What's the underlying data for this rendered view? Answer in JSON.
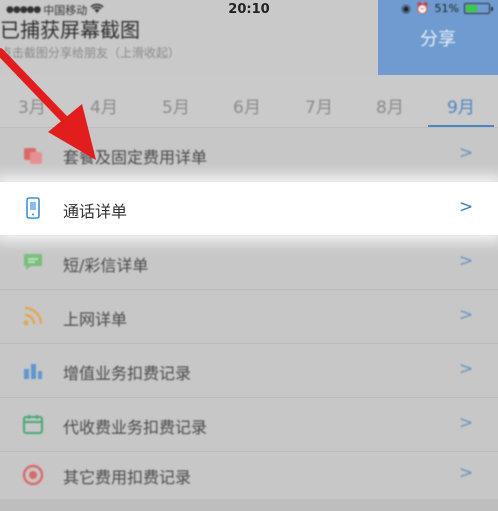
{
  "status_bar": {
    "carrier": "中国移动",
    "time": "20:10",
    "battery": "51%"
  },
  "capture": {
    "title": "已捕获屏幕截图",
    "subtitle": "点击截图分享给朋友（上滑收起）",
    "share_label": "分享"
  },
  "months": {
    "tabs": [
      "3月",
      "4月",
      "5月",
      "6月",
      "7月",
      "8月",
      "9月"
    ],
    "active_index": 6
  },
  "menu": {
    "items": [
      {
        "label": "套餐及固定费用详单",
        "icon": "package-icon",
        "color": "#e25b5b"
      },
      {
        "label": "通话详单",
        "icon": "phone-icon",
        "color": "#3b8fd6"
      },
      {
        "label": "短/彩信详单",
        "icon": "message-icon",
        "color": "#4caf50"
      },
      {
        "label": "上网详单",
        "icon": "rss-icon",
        "color": "#f0a43a"
      },
      {
        "label": "增值业务扣费记录",
        "icon": "bar-chart-icon",
        "color": "#3b8fd6"
      },
      {
        "label": "代收费业务扣费记录",
        "icon": "calendar-icon",
        "color": "#3aa86b"
      },
      {
        "label": "其它费用扣费记录",
        "icon": "target-icon",
        "color": "#e25b5b"
      }
    ],
    "highlighted_index": 1
  },
  "colors": {
    "accent": "#4c86c4",
    "annotation_arrow": "#e21d1d",
    "share_button": "#6f9bd0"
  }
}
